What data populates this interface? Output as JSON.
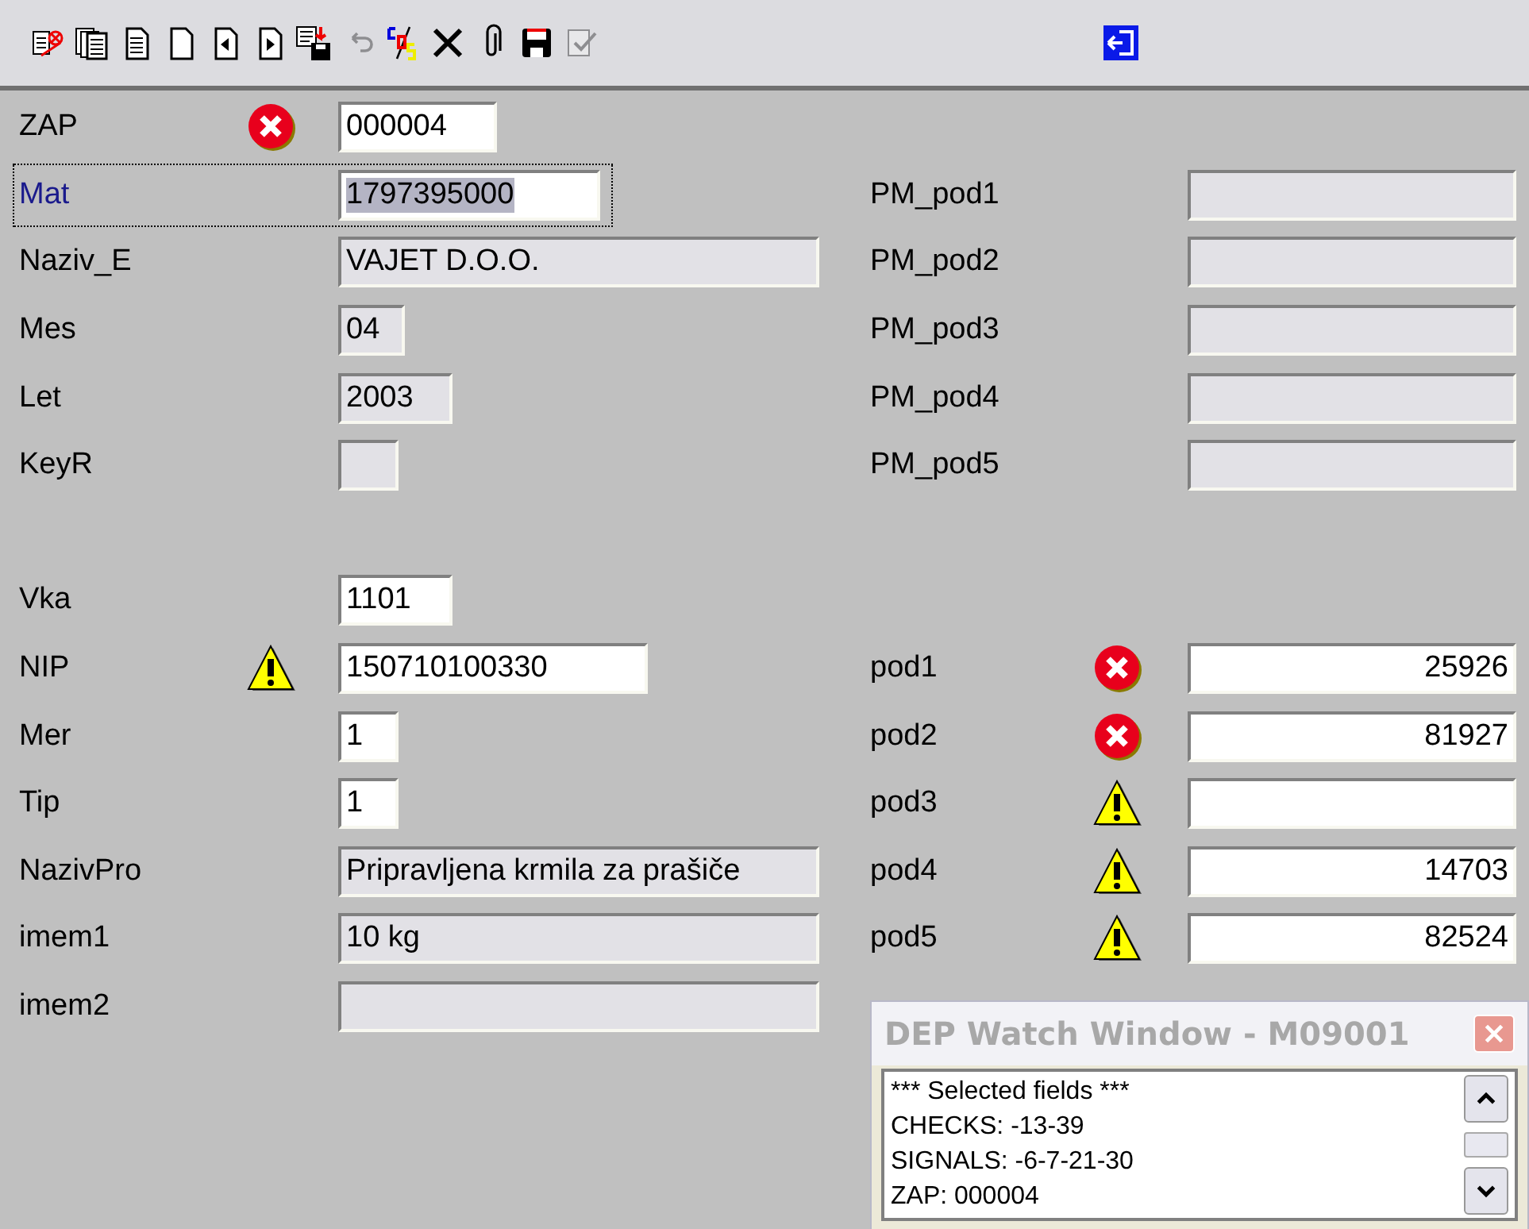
{
  "toolbar": {
    "left": [
      {
        "kind": "delete-record",
        "disabled": false
      },
      {
        "kind": "pages",
        "disabled": false
      },
      {
        "kind": "document",
        "disabled": false
      },
      {
        "kind": "blank-page",
        "disabled": false
      },
      {
        "kind": "page-prev",
        "disabled": false
      },
      {
        "kind": "page-next",
        "disabled": false
      },
      {
        "kind": "save-to-disk",
        "disabled": false
      },
      {
        "kind": "undo",
        "disabled": true
      },
      {
        "kind": "cds",
        "disabled": false
      },
      {
        "kind": "cross",
        "disabled": false
      },
      {
        "kind": "paperclip",
        "disabled": false
      },
      {
        "kind": "floppy",
        "disabled": false
      },
      {
        "kind": "checklist",
        "disabled": true
      }
    ],
    "right": [
      {
        "kind": "exit",
        "disabled": false
      }
    ]
  },
  "left_sections": [
    [
      {
        "label": "ZAP",
        "value": "000004",
        "editable": true,
        "focused": false,
        "kind": "error"
      },
      {
        "label": "Mat",
        "value": "1797395000",
        "editable": true,
        "focused": true,
        "kind": "plain"
      },
      {
        "label": "Naziv_E",
        "value": "VAJET D.O.O.",
        "editable": false,
        "focused": false,
        "kind": "plain"
      },
      {
        "label": "Mes",
        "value": "04",
        "editable": false,
        "focused": false,
        "kind": "plain"
      },
      {
        "label": "Let",
        "value": "2003",
        "editable": false,
        "focused": false,
        "kind": "plain"
      },
      {
        "label": "KeyR",
        "editable": false,
        "focused": false,
        "kind": "plain"
      }
    ],
    [
      {
        "label": "Vka",
        "value": "1101",
        "editable": true,
        "focused": false,
        "kind": "plain"
      },
      {
        "label": "NIP",
        "value": "150710100330",
        "editable": true,
        "focused": false,
        "kind": "warning"
      },
      {
        "label": "Mer",
        "value": "1",
        "editable": true,
        "focused": false,
        "kind": "plain"
      },
      {
        "label": "Tip",
        "value": "1",
        "editable": true,
        "focused": false,
        "kind": "plain"
      },
      {
        "label": "NazivPro",
        "value": "Pripravljena krmila za prašiče",
        "editable": false,
        "focused": false,
        "kind": "plain"
      },
      {
        "label": "imem1",
        "value": "10  kg",
        "editable": false,
        "focused": false,
        "kind": "plain"
      },
      {
        "label": "imem2",
        "editable": false,
        "focused": false,
        "kind": "plain"
      }
    ]
  ],
  "right_sections": [
    [
      {
        "label": "PM_pod1",
        "editable": false,
        "kind": "plain"
      },
      {
        "label": "PM_pod2",
        "editable": false,
        "kind": "plain"
      },
      {
        "label": "PM_pod3",
        "editable": false,
        "kind": "plain"
      },
      {
        "label": "PM_pod4",
        "editable": false,
        "kind": "plain"
      },
      {
        "label": "PM_pod5",
        "editable": false,
        "kind": "plain"
      }
    ],
    [
      {
        "label": "pod1",
        "value": "25926",
        "editable": true,
        "kind": "error"
      },
      {
        "label": "pod2",
        "value": "81927",
        "editable": true,
        "kind": "error"
      },
      {
        "label": "pod3",
        "editable": true,
        "kind": "warning"
      },
      {
        "label": "pod4",
        "value": "14703",
        "editable": true,
        "kind": "warning"
      },
      {
        "label": "pod5",
        "value": "82524",
        "editable": true,
        "kind": "warning"
      }
    ]
  ],
  "watch_window": {
    "title": "DEP Watch Window - M09001",
    "active": false,
    "lines": [
      "*** Selected fields ***",
      "CHECKS: -13-39",
      "SIGNALS: -6-7-21-30",
      "ZAP: 000004"
    ]
  }
}
